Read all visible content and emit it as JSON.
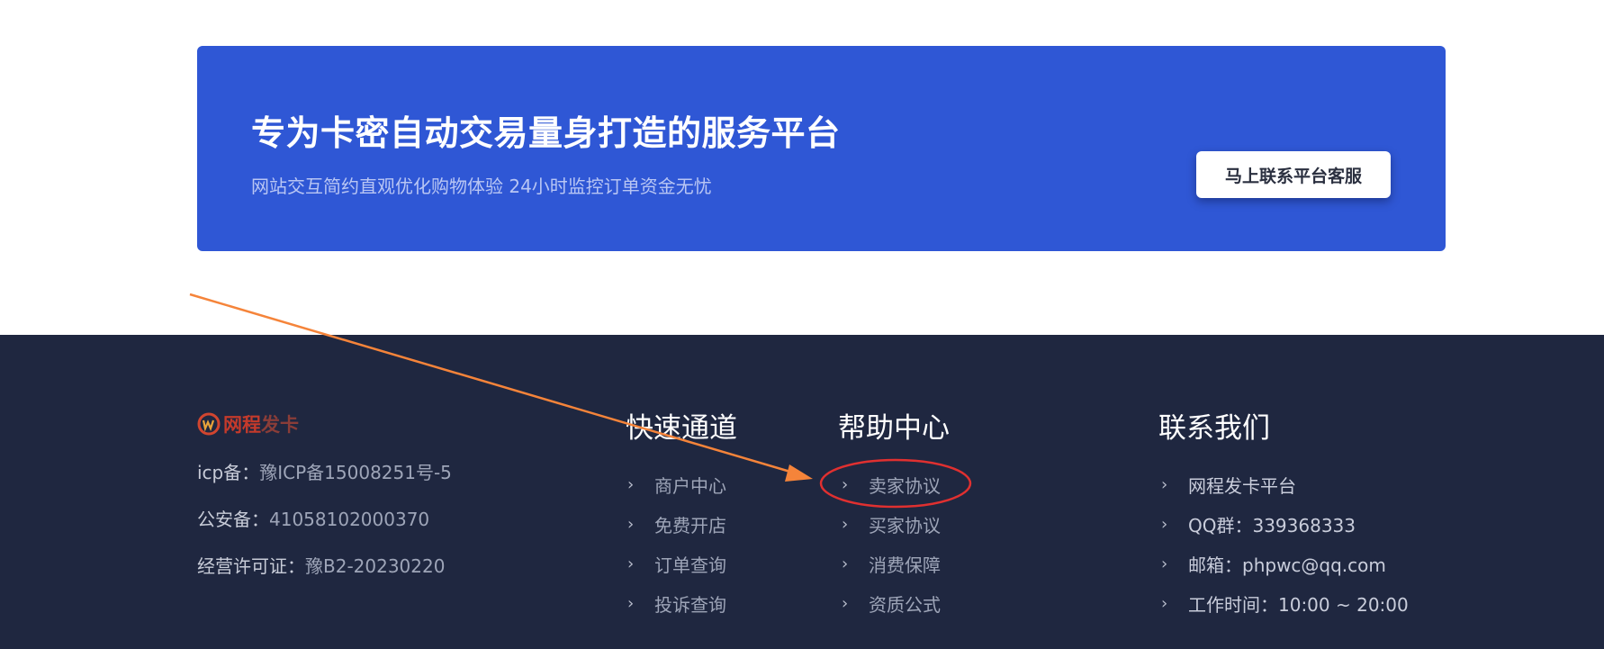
{
  "banner": {
    "title": "专为卡密自动交易量身打造的服务平台",
    "subtitle": "网站交互简约直观优化购物体验 24小时监控订单资金无忧",
    "cta_label": "马上联系平台客服"
  },
  "footer": {
    "logo": {
      "part1": "网程",
      "part2": "发卡"
    },
    "info": [
      {
        "label": "icp备：",
        "value": "豫ICP备15008251号-5"
      },
      {
        "label": "公安备：",
        "value": "41058102000370"
      },
      {
        "label": "经营许可证：",
        "value": "豫B2-20230220"
      }
    ],
    "columns": {
      "quick": {
        "title": "快速通道",
        "items": [
          "商户中心",
          "免费开店",
          "订单查询",
          "投诉查询"
        ]
      },
      "help": {
        "title": "帮助中心",
        "items": [
          "卖家协议",
          "买家协议",
          "消费保障",
          "资质公式"
        ]
      },
      "contact": {
        "title": "联系我们",
        "items": [
          "网程发卡平台",
          "QQ群：339368333",
          "邮箱：phpwc@qq.com",
          "工作时间：10:00 ~ 20:00"
        ]
      }
    }
  },
  "colors": {
    "banner_bg": "#2f57d5",
    "footer_bg": "#1f2740",
    "annotation_arrow": "#f5843a",
    "annotation_circle": "#e03030"
  },
  "icons": {
    "list_bullet": "chevron-right-icon",
    "logo_mark": "logo-icon"
  }
}
